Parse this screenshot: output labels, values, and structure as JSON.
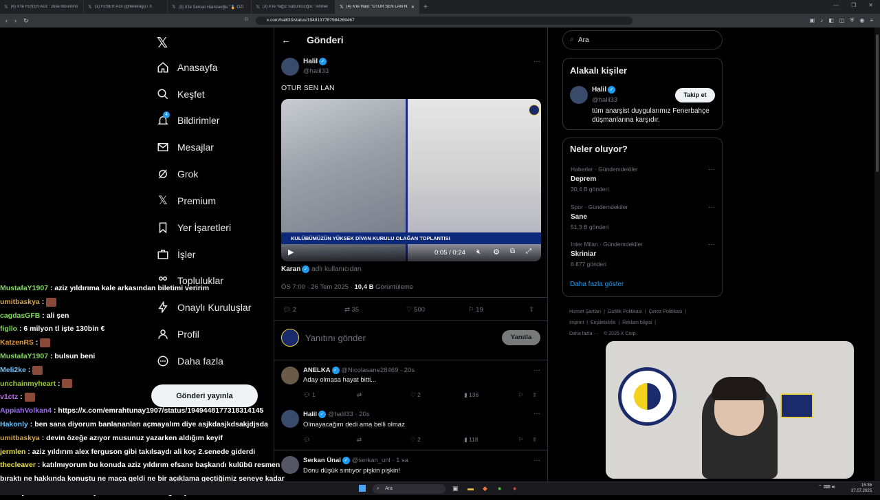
{
  "browser": {
    "tabs": [
      {
        "label": "(4) X'te FENER AĞI: \"Jose Mourinho"
      },
      {
        "label": "(1) FENER AĞI (@feneragi) / X"
      },
      {
        "label": "(3) X'te Sercan Hamzaoğlu \"🏅 ÖZİ"
      },
      {
        "label": "(3) X'te Yağız Sabuncuoğlu: \"Ahmet"
      },
      {
        "label": "(4) X'te Halil: \"OTUR SEN LAN ht"
      }
    ],
    "url": "x.com/halil33/status/1949137787984269467"
  },
  "sidebar": {
    "items": [
      {
        "label": "Anasayfa"
      },
      {
        "label": "Keşfet"
      },
      {
        "label": "Bildirimler",
        "badge": "4"
      },
      {
        "label": "Mesajlar"
      },
      {
        "label": "Grok"
      },
      {
        "label": "Premium"
      },
      {
        "label": "Yer İşaretleri"
      },
      {
        "label": "İşler"
      },
      {
        "label": "Topluluklar"
      },
      {
        "label": "Onaylı Kuruluşlar"
      },
      {
        "label": "Profil"
      },
      {
        "label": "Daha fazla"
      }
    ],
    "post_button": "Gönderi yayınla"
  },
  "main": {
    "header": "Gönderi",
    "post": {
      "name": "Halil",
      "handle": "@halil33",
      "text": "OTUR SEN LAN",
      "video_banner": "KULÜBÜMÜZÜN YÜKSEK DİVAN KURULU OLAĞAN TOPLANTISI",
      "video_time": "0:05 / 0:24",
      "source_name": "Karan",
      "source_suffix": "adlı kullanıcıdan",
      "time": "ÖS 7:00 · 26 Tem 2025 ·",
      "views": "10,4 B",
      "views_label": "Görüntüleme",
      "replies": "2",
      "reposts": "35",
      "likes": "500",
      "bookmarks": "19"
    },
    "composer": {
      "placeholder": "Yanıtını gönder",
      "button": "Yanıtla"
    },
    "replies": [
      {
        "name": "ANELKA",
        "handle": "@Nicolasane28469 · 20s",
        "text": "Aday olmasa hayat bitti...",
        "replies": "1",
        "likes": "2",
        "views": "136"
      },
      {
        "name": "Halil",
        "handle": "@halil33 · 20s",
        "text": "Olmayacağım dedi ama belli olmaz",
        "likes": "2",
        "views": "118"
      },
      {
        "name": "Serkan Ünal",
        "handle": "@serkan_unl · 1 sa",
        "text": "Donu düşük sıntıyor pişkin pişkin!"
      }
    ]
  },
  "right": {
    "search_placeholder": "Ara",
    "relevant": {
      "title": "Alakalı kişiler",
      "name": "Halil",
      "handle": "@halil33",
      "bio": "tüm anarşist duygularımız Fenerbahçe düşmanlarına karşıdır.",
      "follow": "Takip et"
    },
    "trending": {
      "title": "Neler oluyor?",
      "items": [
        {
          "context": "Haberler · Gündemdekiler",
          "name": "Deprem",
          "count": "30,4 B gönderi"
        },
        {
          "context": "Spor · Gündemdekiler",
          "name": "Sane",
          "count": "51,3 B gönderi"
        },
        {
          "context": "Inter Milan · Gündemdekiler",
          "name": "Skriniar",
          "count": "8.877 gönderi"
        }
      ],
      "more": "Daha fazla göster"
    },
    "footer": {
      "l1": [
        "Hizmet Şartları",
        "Gizlilik Politikası",
        "Çerez Politikası"
      ],
      "l2": [
        "Imprint",
        "Erişilebilirlik",
        "Reklam bilgisi"
      ],
      "l3": [
        "Daha fazla ···",
        "© 2025 X Corp."
      ]
    }
  },
  "chat": [
    {
      "user": "MustafaY1907",
      "color": "#7ed957",
      "msg": "aziz yıldırıma kale arkasından biletimi veririm"
    },
    {
      "user": "umitbaskya",
      "color": "#d4a64a",
      "msg": "",
      "emote": true
    },
    {
      "user": "cagdasGFB",
      "color": "#7ed957",
      "msg": "ali şen"
    },
    {
      "user": "figllo",
      "color": "#7ed957",
      "msg": "6 milyon tl işte 130bin €"
    },
    {
      "user": "KatzenRS",
      "color": "#e89a3a",
      "msg": "",
      "emote": true
    },
    {
      "user": "MustafaY1907",
      "color": "#7ed957",
      "msg": "bulsun beni"
    },
    {
      "user": "Meli2ke",
      "color": "#66c3ff",
      "msg": "",
      "emote": true
    },
    {
      "user": "unchainmyheart",
      "color": "#9acd32",
      "msg": "",
      "emote": true
    },
    {
      "user": "v1ctz",
      "color": "#c06cf0",
      "msg": "",
      "emote": true
    },
    {
      "user": "AppiahVolkan4",
      "color": "#9b6cf0",
      "msg": "https://x.com/emrahtunay1907/status/1949448177318314145"
    },
    {
      "user": "Hakonly",
      "color": "#66c3ff",
      "msg": "ben sana diyorum banlananları açmayalım diye asjkdasjkdsakjdjsda"
    },
    {
      "user": "umitbaskya",
      "color": "#d4a64a",
      "msg": "devin özeğe azıyor musunuz yazarken aldığım keyif"
    },
    {
      "user": "jermlen",
      "color": "#e8e34a",
      "msg": "aziz yıldırım alex ferguson gibi takılsaydı ali koç 2.senede giderdi"
    },
    {
      "user": "thecleaver",
      "color": "#e8e34a",
      "msg": "katılmıyorum bu konuda aziz yıldırım efsane başkandı kulübü resmen bıraktı ne hakkında konuştu ne maça geldi ne bir açıklama geçtiğimiz seneye kadar orada yoktu ben kabul etmiyorum bahane olarak görüyorum"
    }
  ],
  "taskbar": {
    "search": "Ara",
    "time": "15:36",
    "date": "27.07.2025"
  }
}
